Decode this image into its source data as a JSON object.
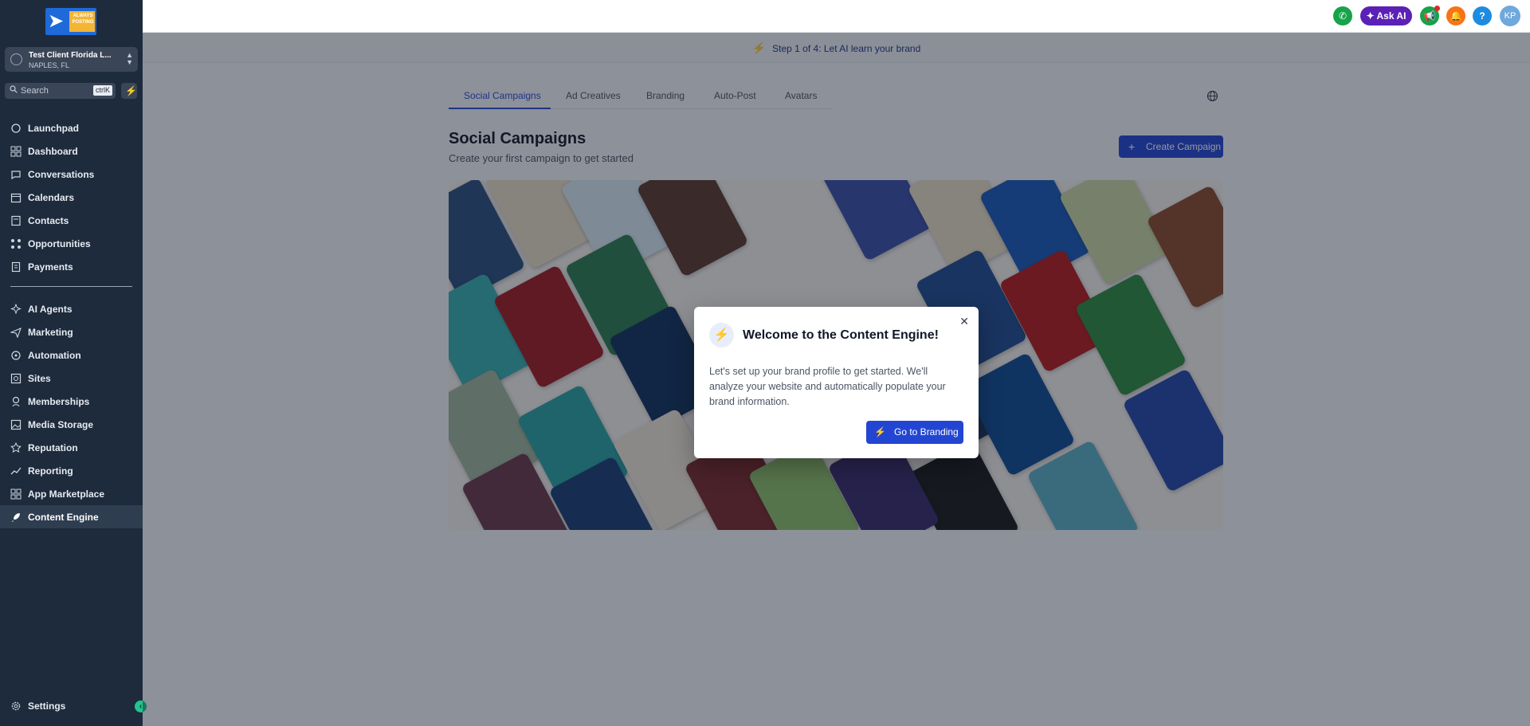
{
  "brand": {
    "logo_text": "ALWAYS POSTING"
  },
  "account": {
    "name": "Test Client Florida L...",
    "location": "NAPLES, FL"
  },
  "search": {
    "placeholder": "Search",
    "shortcut": "ctrlK"
  },
  "sidebar": {
    "items_top": [
      {
        "label": "Launchpad",
        "icon": "launchpad-icon"
      },
      {
        "label": "Dashboard",
        "icon": "dashboard-icon"
      },
      {
        "label": "Conversations",
        "icon": "chat-icon"
      },
      {
        "label": "Calendars",
        "icon": "calendar-icon"
      },
      {
        "label": "Contacts",
        "icon": "contacts-icon"
      },
      {
        "label": "Opportunities",
        "icon": "opportunities-icon"
      },
      {
        "label": "Payments",
        "icon": "payments-icon"
      }
    ],
    "items_bottom": [
      {
        "label": "AI Agents",
        "icon": "ai-agents-icon"
      },
      {
        "label": "Marketing",
        "icon": "marketing-icon"
      },
      {
        "label": "Automation",
        "icon": "automation-icon"
      },
      {
        "label": "Sites",
        "icon": "sites-icon"
      },
      {
        "label": "Memberships",
        "icon": "memberships-icon"
      },
      {
        "label": "Media Storage",
        "icon": "media-icon"
      },
      {
        "label": "Reputation",
        "icon": "star-icon"
      },
      {
        "label": "Reporting",
        "icon": "reporting-icon"
      },
      {
        "label": "App Marketplace",
        "icon": "marketplace-icon"
      },
      {
        "label": "Content Engine",
        "icon": "rocket-icon",
        "active": true
      }
    ],
    "settings": "Settings"
  },
  "topbar": {
    "ask_ai": "Ask AI",
    "help": "?",
    "user_initials": "KP"
  },
  "step_banner": "Step 1 of 4: Let AI learn your brand",
  "tabs": [
    "Social Campaigns",
    "Ad Creatives",
    "Branding",
    "Auto-Post",
    "Avatars"
  ],
  "main": {
    "title": "Social Campaigns",
    "subtitle": "Create your first campaign to get started",
    "create_button": "Create Campaign"
  },
  "modal": {
    "title": "Welcome to the Content Engine!",
    "body": "Let's set up your brand profile to get started. We'll analyze your website and automatically populate your brand information.",
    "button": "Go to Branding"
  },
  "colors": {
    "sidebar": "#1e2b3c",
    "primary": "#2346d2",
    "accent_green": "#22c55e",
    "ask_ai": "#5b21b6"
  }
}
